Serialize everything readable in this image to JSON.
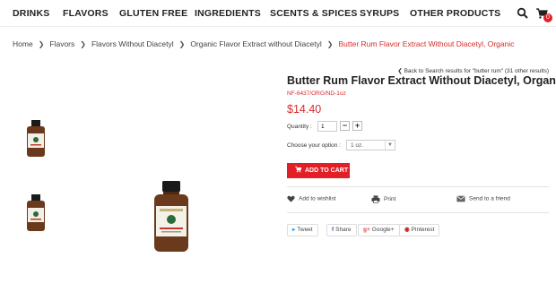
{
  "nav": {
    "items": [
      "DRINKS",
      "FLAVORS",
      "GLUTEN FREE",
      "INGREDIENTS",
      "SCENTS & SPICES",
      "SYRUPS",
      "OTHER PRODUCTS"
    ],
    "cart_count": "0"
  },
  "breadcrumb": {
    "items": [
      "Home",
      "Flavors",
      "Flavors Without Diacetyl",
      "Organic Flavor Extract without Diacetyl"
    ],
    "current": "Butter Rum Flavor Extract Without Diacetyl, Organic"
  },
  "product": {
    "back_link": "Back to Search results for \"butter rum\" (31 other results)",
    "title": "Butter Rum Flavor Extract Without Diacetyl, Organic",
    "sku": "NF-6437/ORG/ND-1oz",
    "price": "$14.40",
    "quantity_label": "Quantity :",
    "quantity_value": "1",
    "option_label": "Choose your option :",
    "option_value": "1 oz.",
    "add_to_cart": "ADD TO CART"
  },
  "actions": {
    "wishlist": "Add to wishlist",
    "print": "Print",
    "send": "Send to a friend"
  },
  "share": {
    "tweet": "Tweet",
    "facebook": "Share",
    "google": "Google+",
    "pinterest": "Pinterest"
  },
  "colors": {
    "accent": "#e21f26",
    "link_red": "#d62b2b"
  }
}
